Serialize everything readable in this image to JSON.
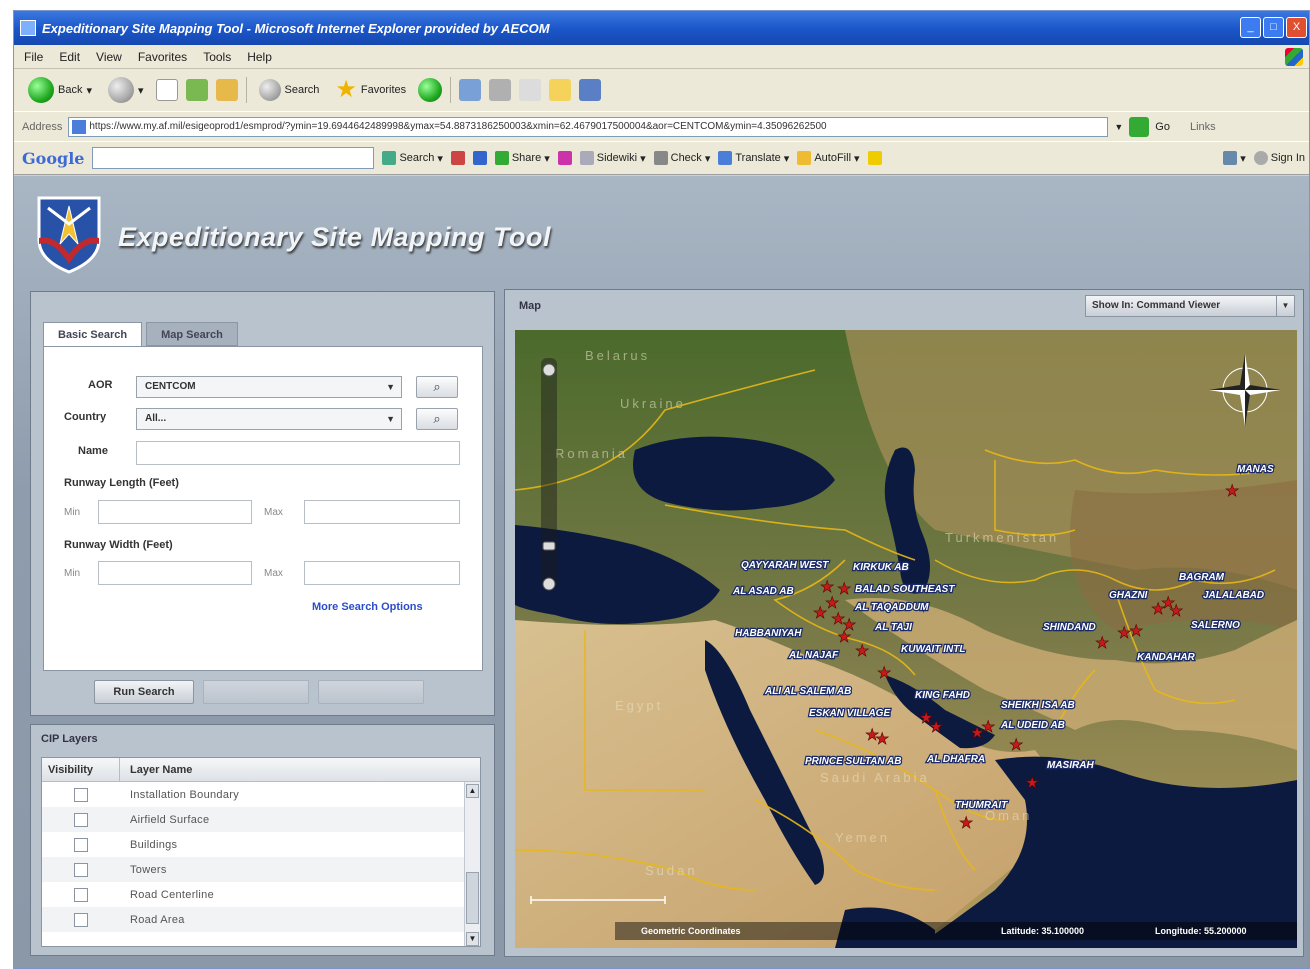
{
  "window": {
    "title": "Expeditionary Site Mapping Tool - Microsoft Internet Explorer provided by AECOM",
    "buttons": [
      "_",
      "□",
      "X"
    ]
  },
  "menu": [
    "File",
    "Edit",
    "View",
    "Favorites",
    "Tools",
    "Help"
  ],
  "toolbar": {
    "back_label": "Back",
    "search_label": "Search",
    "favorites_label": "Favorites"
  },
  "address": {
    "label": "Address",
    "url": "https://www.my.af.mil/esigeoprod1/esmprod/?ymin=19.6944642489998&ymax=54.8873186250003&xmin=62.4679017500004&aor=CENTCOM&ymin=4.35096262500",
    "go_label": "Go",
    "links_label": "Links"
  },
  "google_bar": {
    "logo": "Google",
    "search_label": "Search",
    "share_label": "Share",
    "sidewiki_label": "Sidewiki",
    "check_label": "Check",
    "translate_label": "Translate",
    "autofill_label": "AutoFill",
    "signin_label": "Sign In"
  },
  "app": {
    "title": "Expeditionary Site Mapping Tool"
  },
  "search": {
    "tabs": [
      "Basic Search",
      "Map Search"
    ],
    "aor_label": "AOR",
    "aor_value": "CENTCOM",
    "country_label": "Country",
    "country_value": "All...",
    "name_label": "Name",
    "runway_length_label": "Runway Length (Feet)",
    "runway_width_label": "Runway Width (Feet)",
    "min_placeholder": "Min",
    "max_label": "Max",
    "more_options": "More Search Options",
    "run_search": "Run Search",
    "button2": "",
    "button3": ""
  },
  "cip": {
    "title": "CIP Layers",
    "col_visibility": "Visibility",
    "col_layer_name": "Layer Name",
    "layers": [
      "Installation Boundary",
      "Airfield Surface",
      "Buildings",
      "Towers",
      "Road Centerline",
      "Road Area"
    ]
  },
  "map": {
    "title": "Map",
    "show_in": "Show In: Command Viewer",
    "scale_text": "",
    "status": {
      "coords": "Geometric Coordinates",
      "latitude": "Latitude: 35.100000",
      "longitude": "Longitude: 55.200000"
    },
    "country_labels": [
      "Belarus",
      "Ukraine",
      "Romania",
      "Turkmenistan",
      "Egypt",
      "Saudi Arabia",
      "Yemen",
      "Sudan",
      "Oman"
    ],
    "sites": [
      "QAYYARAH WEST",
      "KIRKUK AB",
      "AL ASAD AB",
      "BALAD SOUTHEAST",
      "AL TAQADDUM",
      "HABBANIYAH",
      "AL TAJI",
      "AL NAJAF",
      "KUWAIT INTL",
      "ALI AL SALEM AB",
      "KING FAHD",
      "ESKAN VILLAGE",
      "SHEIKH ISA AB",
      "PRINCE SULTAN AB",
      "AL DHAFRA",
      "AL UDEID AB",
      "THUMRAIT",
      "MASIRAH",
      "BAGRAM",
      "GHAZNI",
      "SHINDAND",
      "KANDAHAR",
      "SALERNO",
      "JALALABAD",
      "MANAS"
    ]
  }
}
